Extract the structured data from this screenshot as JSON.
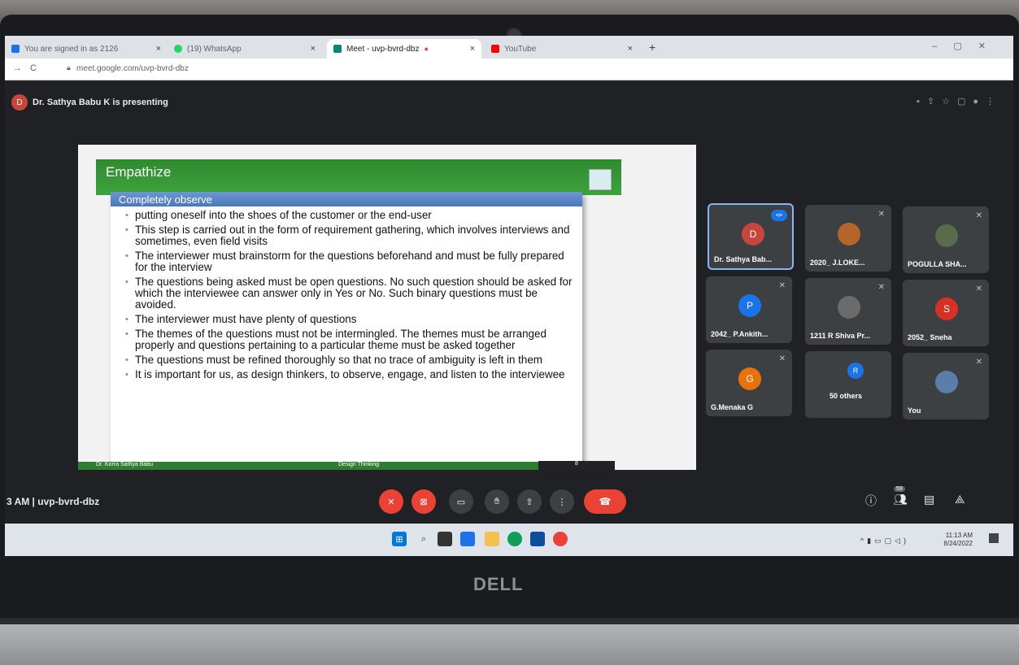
{
  "browser": {
    "tabs": [
      {
        "label": "You are signed in as 2126",
        "color": "#1a73e8"
      },
      {
        "label": "(19) WhatsApp",
        "color": "#25d366"
      },
      {
        "label": "Meet - uvp-bvrd-dbz",
        "color": "#00897b"
      },
      {
        "label": "YouTube",
        "color": "#ff0000"
      }
    ],
    "new_tab": "+",
    "url": "meet.google.com/uvp-bvrd-dbz"
  },
  "meet": {
    "presenter_initial": "D",
    "presenting_text": "Dr. Sathya Babu K is presenting",
    "meeting_time_code": "3 AM  |  uvp-bvrd-dbz",
    "people_count": "59"
  },
  "slide": {
    "title": "Empathize",
    "section": "Completely observe",
    "bullets": [
      "putting oneself into the shoes of the customer or the end-user",
      "This step is carried out in the form of requirement gathering, which involves interviews and sometimes, even field visits",
      "The interviewer must brainstorm for the questions beforehand and must be fully prepared for the interview",
      "The questions being asked must be open questions. No such question should be asked for which the interviewee can answer only in Yes or No. Such binary questions must be avoided.",
      "The interviewer must have plenty of questions",
      "The themes of the questions must not be intermingled. The themes must be arranged properly and questions pertaining to a particular theme must be asked together",
      "The questions must be refined thoroughly so that no trace of ambiguity is left in them",
      "It is important for us, as design thinkers, to observe, engage, and listen to the interviewee"
    ],
    "footer_left": "Dr. Korra Sathya Babu",
    "footer_center": "Design Thinking",
    "footer_page": "8"
  },
  "participants": [
    {
      "name": "Dr. Sathya Bab...",
      "initial": "D",
      "color": "#c8453a"
    },
    {
      "name": "2020_ J.LOKE...",
      "initial": "",
      "color": "#b5652a"
    },
    {
      "name": "POGULLA SHA...",
      "initial": "",
      "color": "#5a6b4c"
    },
    {
      "name": "2042_ P.Ankith...",
      "initial": "P",
      "color": "#1a73e8"
    },
    {
      "name": "1211 R Shiva Pr...",
      "initial": "",
      "color": "#6b6b6b"
    },
    {
      "name": "2052_ Sneha",
      "initial": "S",
      "color": "#d93025"
    },
    {
      "name": "G.Menaka G",
      "initial": "G",
      "color": "#e8710a"
    },
    {
      "name": "50 others",
      "initial": "R",
      "color": "#1a73e8"
    },
    {
      "name": "You",
      "initial": "",
      "color": "#5b7ea8"
    }
  ],
  "taskbar": {
    "time": "11:13 AM",
    "date": "8/24/2022"
  },
  "brand": "DELL"
}
